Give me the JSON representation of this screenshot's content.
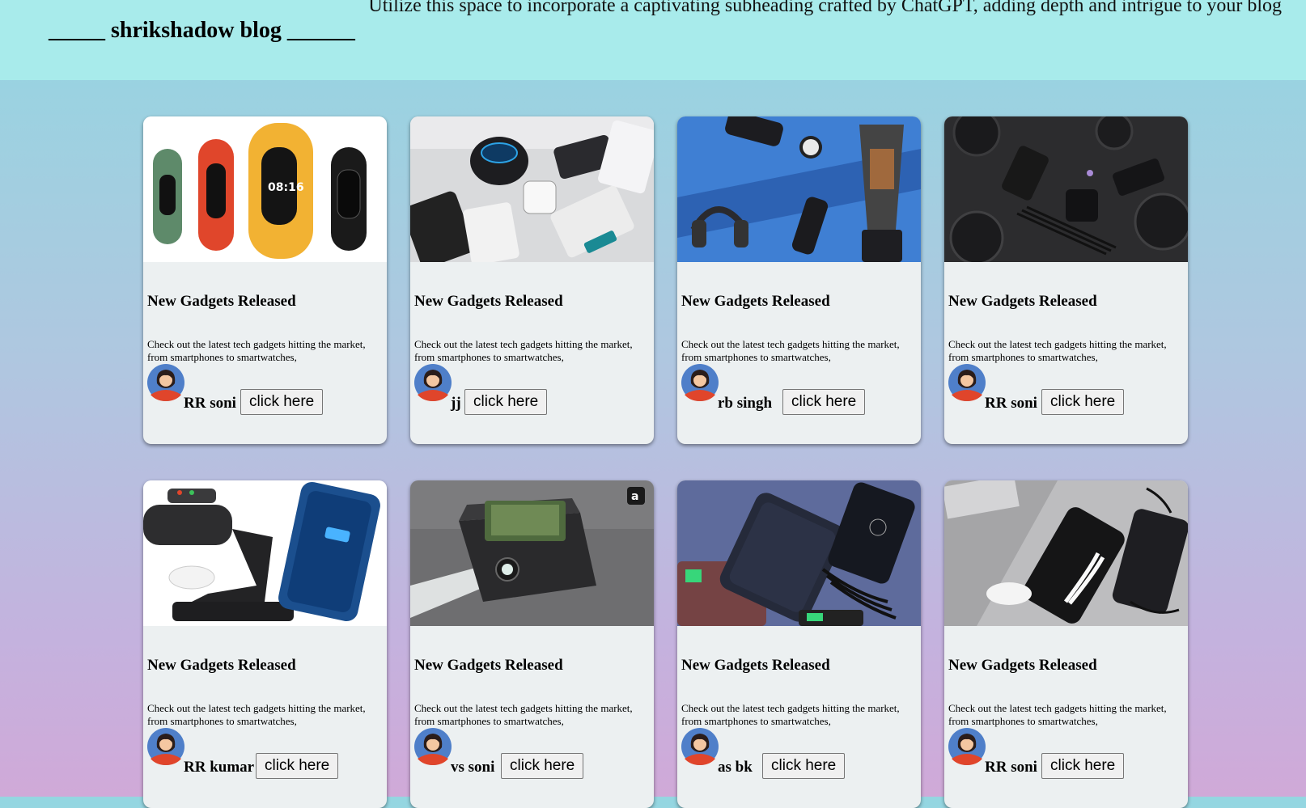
{
  "header": {
    "blog_title": "_____ shrikshadow blog ______",
    "subheading": "Utilize this space to incorporate a captivating subheading crafted by ChatGPT, adding depth and intrigue to your blog"
  },
  "cards": [
    {
      "title": "New Gadgets Released",
      "description": "Check out the latest tech gadgets hitting the market, from smartphones to smartwatches,",
      "author": "RR soni",
      "button": "click here",
      "image": "fitness-bands-image"
    },
    {
      "title": "New Gadgets Released",
      "description": "Check out the latest tech gadgets hitting the market, from smartphones to smartwatches,",
      "author": "jj",
      "button": "click here",
      "image": "devices-flatlay-image"
    },
    {
      "title": "New Gadgets Released",
      "description": "Check out the latest tech gadgets hitting the market, from smartphones to smartwatches,",
      "author": "rb singh",
      "button": "click here",
      "image": "gadgets-blue-image"
    },
    {
      "title": "New Gadgets Released",
      "description": "Check out the latest tech gadgets hitting the market, from smartphones to smartwatches,",
      "author": "RR soni",
      "button": "click here",
      "image": "black-accessories-image"
    },
    {
      "title": "New Gadgets Released",
      "description": "Check out the latest tech gadgets hitting the market, from smartphones to smartwatches,",
      "author": "RR kumar",
      "button": "click here",
      "image": "wireless-charger-image"
    },
    {
      "title": "New Gadgets Released",
      "description": "Check out the latest tech gadgets hitting the market, from smartphones to smartwatches,",
      "author": "vs soni",
      "button": "click here",
      "image": "mini-projector-image"
    },
    {
      "title": "New Gadgets Released",
      "description": "Check out the latest tech gadgets hitting the market, from smartphones to smartwatches,",
      "author": "as bk",
      "button": "click here",
      "image": "power-bank-image"
    },
    {
      "title": "New Gadgets Released",
      "description": "Check out the latest tech gadgets hitting the market, from smartphones to smartwatches,",
      "author": "RR soni",
      "button": "click here",
      "image": "phone-accessories-image"
    }
  ],
  "colors": {
    "header_bg": "#a8ebeb",
    "card_bg": "#ecf0f1",
    "avatar_bg": "#4f7fc9",
    "avatar_shirt": "#e0452b"
  }
}
